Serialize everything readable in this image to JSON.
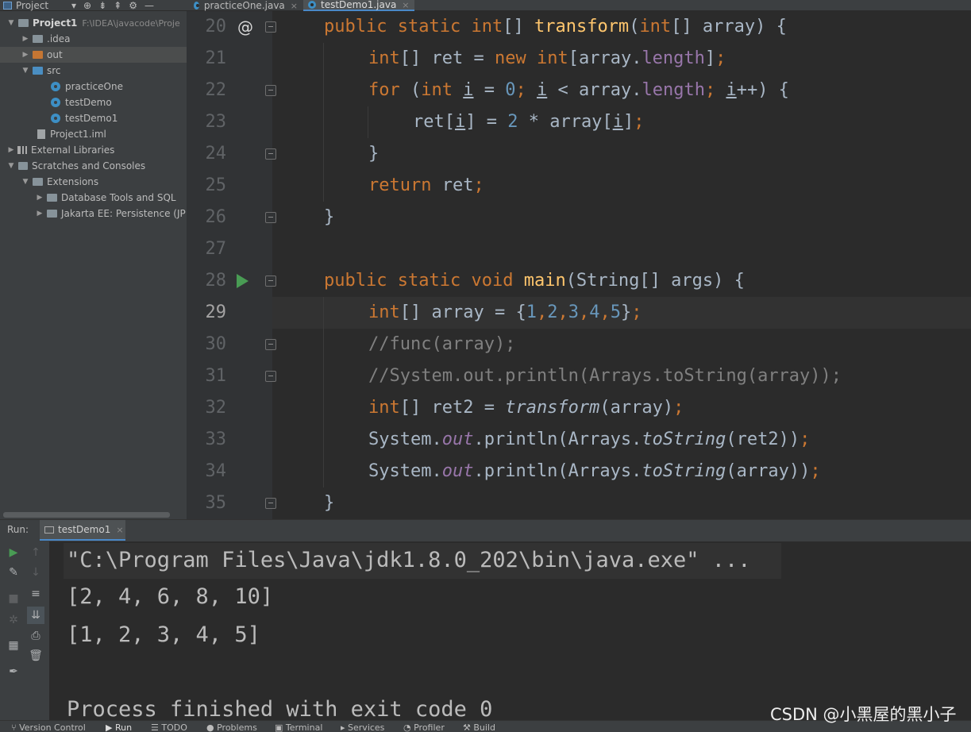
{
  "top": {
    "project_label": "Project",
    "tabs": [
      {
        "label": "practiceOne.java",
        "active": false
      },
      {
        "label": "testDemo1.java",
        "active": true
      }
    ]
  },
  "project_tree": {
    "root": {
      "label": "Project1",
      "path": "F:\\IDEA\\javacode\\Proje"
    },
    "items": [
      {
        "label": ".idea",
        "type": "folder"
      },
      {
        "label": "out",
        "type": "folder-orange"
      },
      {
        "label": "src",
        "type": "folder-blue"
      },
      {
        "label": "practiceOne",
        "type": "class"
      },
      {
        "label": "testDemo",
        "type": "class"
      },
      {
        "label": "testDemo1",
        "type": "class"
      },
      {
        "label": "Project1.iml",
        "type": "file"
      },
      {
        "label": "External Libraries",
        "type": "library"
      },
      {
        "label": "Scratches and Consoles",
        "type": "scratch"
      },
      {
        "label": "Extensions",
        "type": "folder"
      },
      {
        "label": "Database Tools and SQL",
        "type": "folder"
      },
      {
        "label": "Jakarta EE: Persistence (JP",
        "type": "folder"
      }
    ]
  },
  "editor": {
    "line_numbers": [
      "20",
      "21",
      "22",
      "23",
      "24",
      "25",
      "26",
      "27",
      "28",
      "29",
      "30",
      "31",
      "32",
      "33",
      "34",
      "35"
    ],
    "current_line": "29",
    "gutter_at": "@"
  },
  "code": {
    "l20": {
      "public": "public",
      "static": "static",
      "int": "int",
      "brk": "[] ",
      "name": "transform",
      "rest1": "(",
      "int2": "int",
      "rest2": "[] array) {"
    },
    "l21": {
      "int": "int",
      "a": "[] ret = ",
      "new": "new",
      "int2": "int",
      "b": "[array.",
      "len": "length",
      "c": "]",
      ";": ";"
    },
    "l22": {
      "for": "for",
      "a": " (",
      "int": "int",
      "b": " ",
      "i1": "i",
      "c": " = ",
      "zero": "0",
      "d": "; ",
      "i2": "i",
      "e": " < array.",
      "len": "length",
      "f": "; ",
      "i3": "i",
      "g": "++) {"
    },
    "l23": {
      "a": "ret[",
      "i1": "i",
      "b": "] = ",
      "two": "2",
      "c": " * array[",
      "i2": "i",
      "d": "]",
      ";": ";"
    },
    "l24": {
      "a": "}"
    },
    "l25": {
      "ret": "return",
      "a": " ret",
      ";": ";"
    },
    "l26": {
      "a": "}"
    },
    "l28": {
      "public": "public",
      "static": "static",
      "void": "void",
      "name": "main",
      "a": "(String[] args) {"
    },
    "l29": {
      "int": "int",
      "a": "[] array = {",
      "n1": "1",
      "c1": ",",
      "n2": "2",
      "c2": ",",
      "n3": "3",
      "c3": ",",
      "n4": "4",
      "c4": ",",
      "n5": "5",
      "b": "}",
      ";": ";"
    },
    "l30": {
      "a": "//func(array);"
    },
    "l31": {
      "a": "//System.out.println(Arrays.toString(array));"
    },
    "l32": {
      "int": "int",
      "a": "[] ret2 = ",
      "fn": "transform",
      "b": "(array)",
      ";": ";"
    },
    "l33": {
      "a": "System.",
      "out": "out",
      "b": ".println(Arrays.",
      "fn": "toString",
      "c": "(ret2))",
      ";": ";"
    },
    "l34": {
      "a": "System.",
      "out": "out",
      "b": ".println(Arrays.",
      "fn": "toString",
      "c": "(array))",
      ";": ";"
    },
    "l35": {
      "a": "}"
    }
  },
  "run": {
    "label": "Run:",
    "tab": "testDemo1",
    "console": [
      "\"C:\\Program Files\\Java\\jdk1.8.0_202\\bin\\java.exe\" ...",
      "[2, 4, 6, 8, 10]",
      "[1, 2, 3, 4, 5]",
      "Process finished with exit code 0"
    ]
  },
  "bottom_tabs": [
    "Version Control",
    "Run",
    "TODO",
    "Problems",
    "Terminal",
    "Services",
    "Profiler",
    "Build"
  ],
  "watermark": "CSDN @小黑屋的黑小子",
  "colors": {
    "keyword": "#cc7832",
    "function": "#ffc66d",
    "number": "#6897bb",
    "field": "#9876aa",
    "comment": "#808080",
    "text": "#a9b7c6"
  }
}
